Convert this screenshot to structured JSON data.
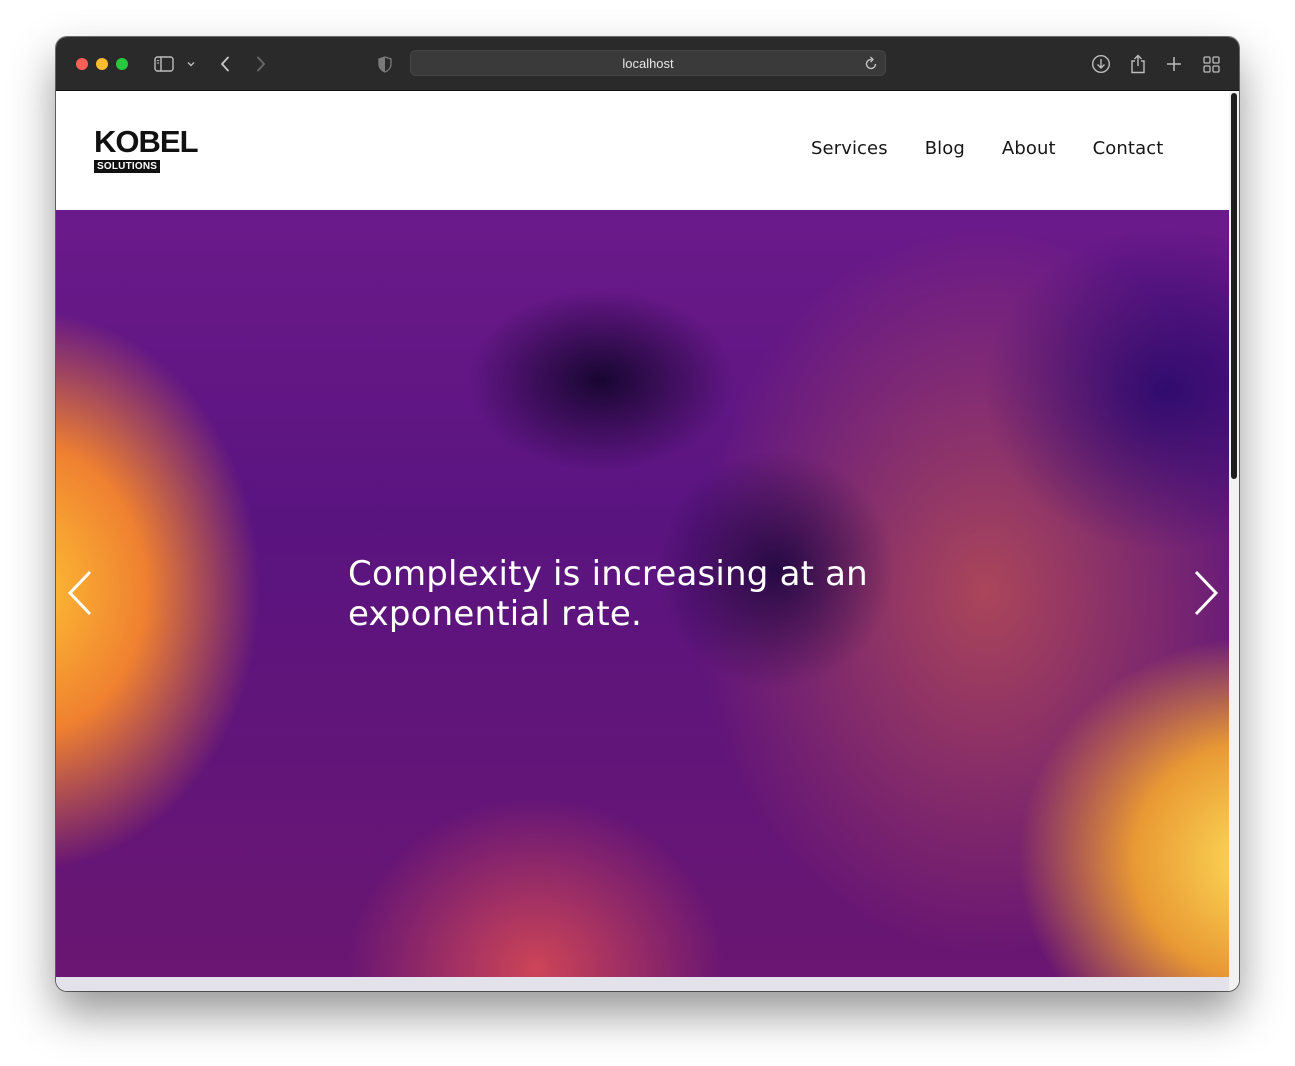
{
  "browser": {
    "url": "localhost"
  },
  "site": {
    "logo": {
      "name": "KOBEL",
      "tagline": "SOLUTIONS"
    },
    "nav": [
      {
        "label": "Services"
      },
      {
        "label": "Blog"
      },
      {
        "label": "About"
      },
      {
        "label": "Contact"
      }
    ]
  },
  "hero": {
    "headline": "Complexity is increasing at an exponential rate."
  },
  "colors": {
    "toolbar": "#2b2a2b",
    "brand": "#111111",
    "hero_purple": "#5a1480",
    "hero_orange": "#ff8c28"
  },
  "icons": {
    "sidebar": "sidebar-icon",
    "back": "chevron-left-icon",
    "forward": "chevron-right-icon",
    "privacy": "shield-icon",
    "reload": "reload-icon",
    "download": "download-icon",
    "share": "share-icon",
    "new_tab": "plus-icon",
    "tab_overview": "grid-icon",
    "carousel_prev": "chevron-left-icon",
    "carousel_next": "chevron-right-icon",
    "scroll_top": "chevron-up-icon"
  }
}
